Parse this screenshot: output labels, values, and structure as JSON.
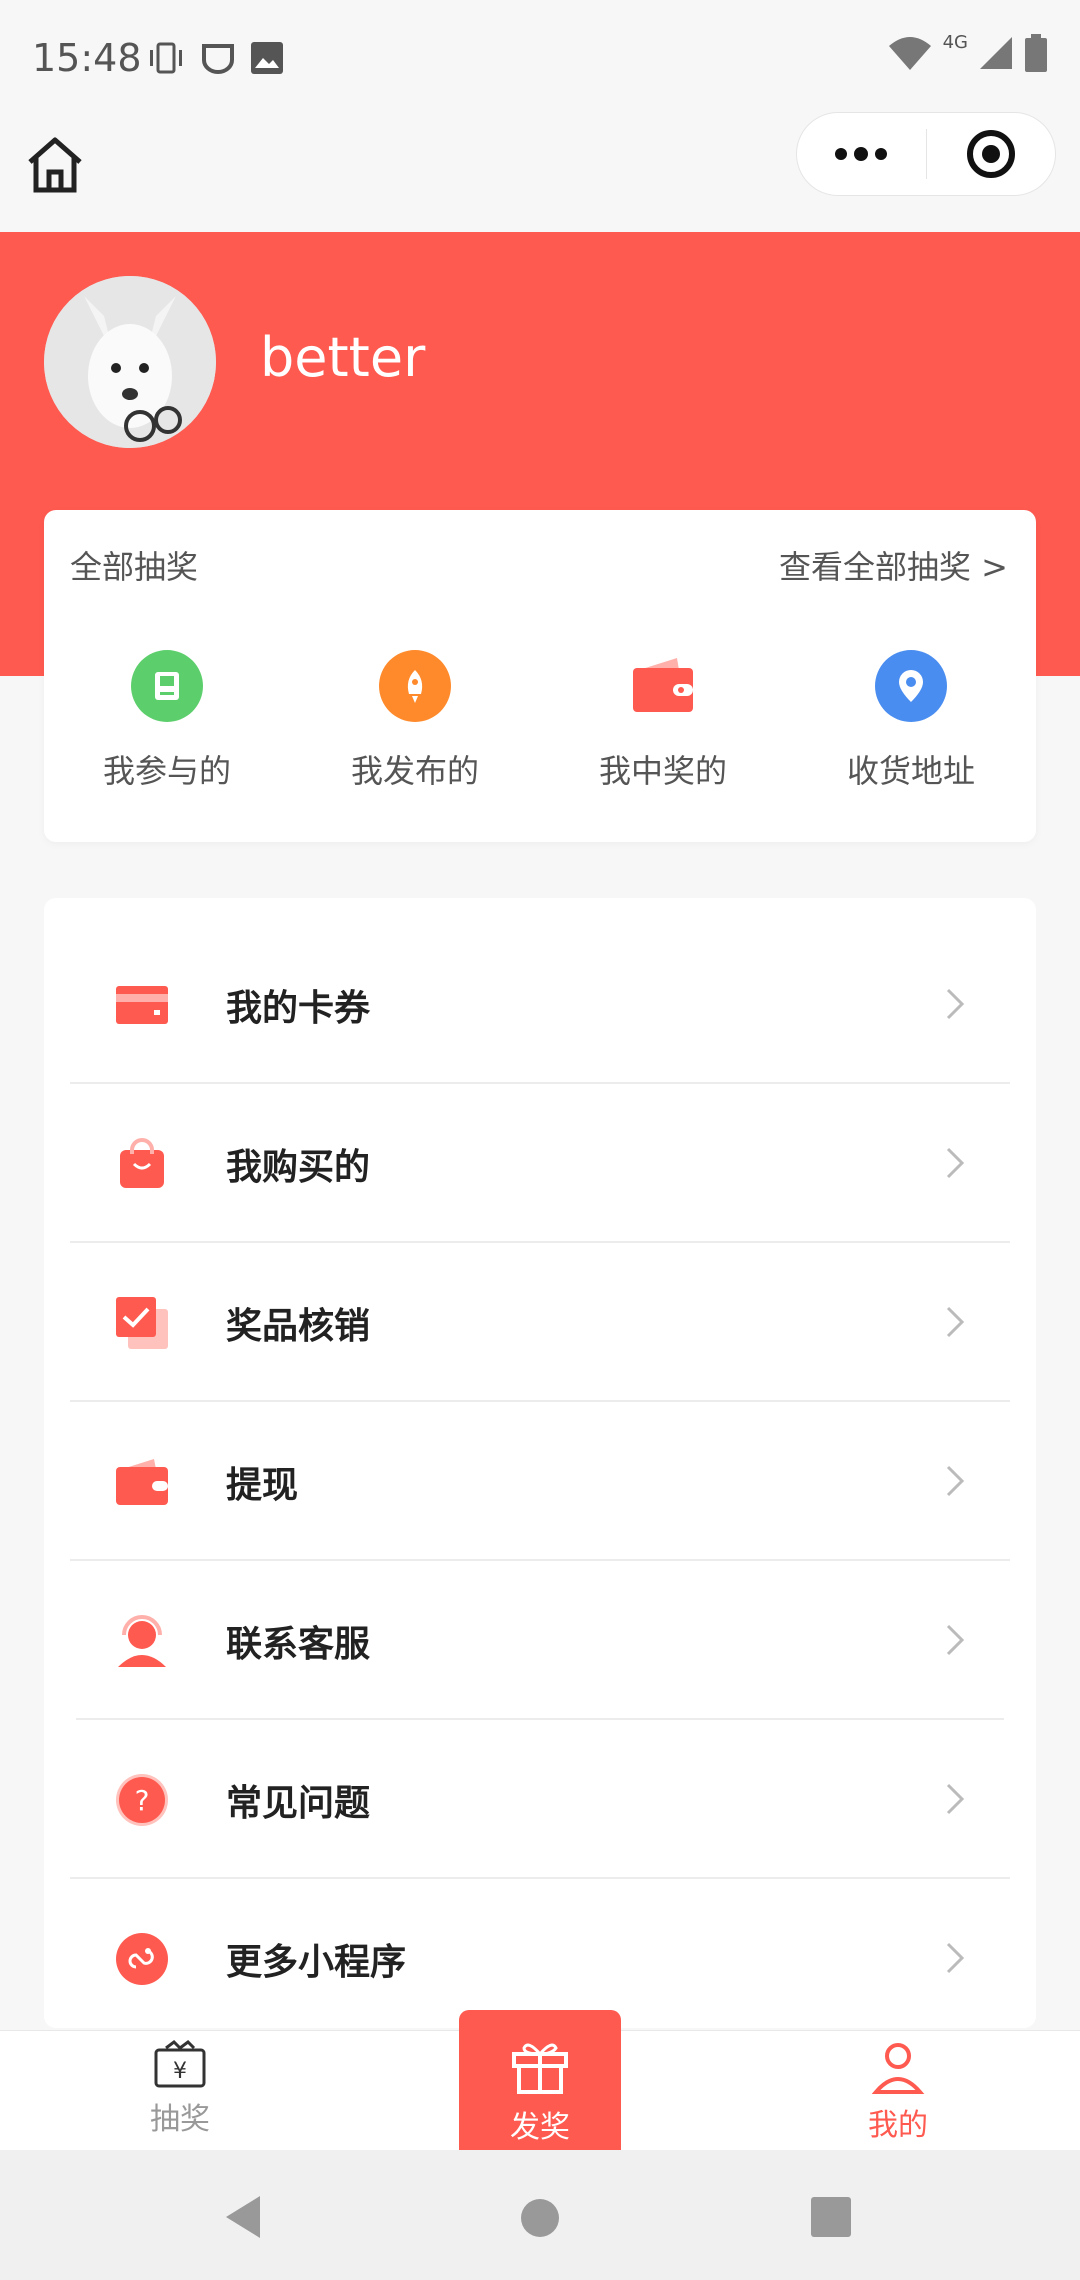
{
  "status_bar": {
    "time": "15:48",
    "network": "4G",
    "icons_left": [
      "vibrate-icon",
      "notification-icon",
      "image-icon"
    ],
    "icons_right": [
      "wifi-icon",
      "signal-icon",
      "battery-icon"
    ]
  },
  "top_bar": {
    "home_icon": "home-icon",
    "capsule_icons": [
      "more-dots-icon",
      "target-close-icon"
    ]
  },
  "profile": {
    "username": "better",
    "avatar_icon": "avatar-dog-image"
  },
  "lottery_card": {
    "title": "全部抽奖",
    "more_link": "查看全部抽奖 >",
    "items": [
      {
        "label": "我参与的",
        "icon": "participated-icon",
        "color": "#5ccf6c"
      },
      {
        "label": "我发布的",
        "icon": "rocket-icon",
        "color": "#ff8a2b"
      },
      {
        "label": "我中奖的",
        "icon": "wallet-icon",
        "color": "#ff5a50"
      },
      {
        "label": "收货地址",
        "icon": "location-icon",
        "color": "#4a8df0"
      }
    ]
  },
  "menu": {
    "items": [
      {
        "label": "我的卡券",
        "icon": "card-icon"
      },
      {
        "label": "我购买的",
        "icon": "shopping-bag-icon"
      },
      {
        "label": "奖品核销",
        "icon": "checkbox-icon"
      },
      {
        "label": "提现",
        "icon": "wallet-icon"
      },
      {
        "label": "联系客服",
        "icon": "customer-service-icon"
      },
      {
        "label": "常见问题",
        "icon": "question-icon"
      },
      {
        "label": "更多小程序",
        "icon": "link-icon"
      }
    ]
  },
  "tab_bar": {
    "tabs": [
      {
        "label": "抽奖",
        "icon": "yen-box-icon",
        "active": false
      },
      {
        "label": "发奖",
        "icon": "gift-icon",
        "active": false
      },
      {
        "label": "我的",
        "icon": "person-icon",
        "active": true
      }
    ],
    "active_color": "#ff5a50",
    "inactive_color": "#999999"
  },
  "system_nav": [
    "back-icon",
    "home-circle-icon",
    "recents-icon"
  ],
  "colors": {
    "brand": "#ff5a50",
    "background": "#f7f7f7"
  }
}
